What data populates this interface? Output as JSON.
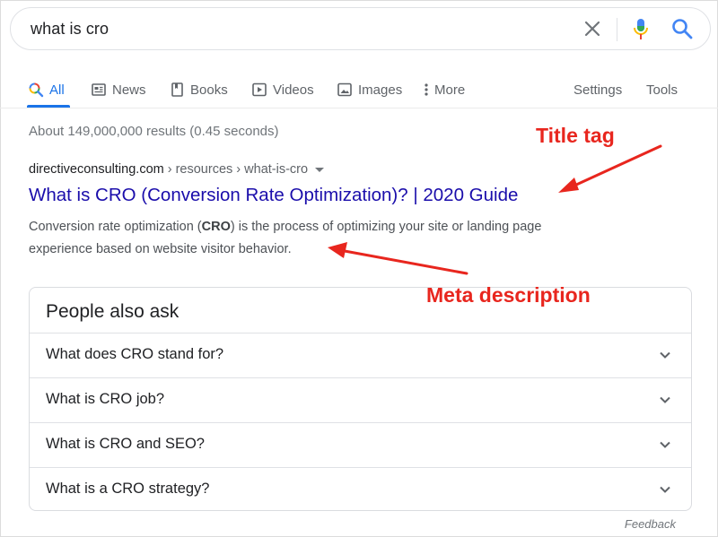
{
  "search": {
    "query": "what is cro",
    "icons": [
      "close-icon",
      "microphone-icon",
      "search-icon"
    ]
  },
  "tabs": [
    {
      "label": "All",
      "icon": "search-colorful-icon",
      "active": true
    },
    {
      "label": "News",
      "icon": "news-icon"
    },
    {
      "label": "Books",
      "icon": "book-icon"
    },
    {
      "label": "Videos",
      "icon": "video-icon"
    },
    {
      "label": "Images",
      "icon": "image-icon"
    },
    {
      "label": "More",
      "icon": "more-vert-icon"
    }
  ],
  "tools": {
    "settings": "Settings",
    "tools": "Tools"
  },
  "result_stats": "About 149,000,000 results (0.45 seconds)",
  "result": {
    "domain": "directiveconsulting.com",
    "breadcrumb": " › resources › what-is-cro",
    "title": "What is CRO (Conversion Rate Optimization)? | 2020 Guide",
    "snippet_before": "Conversion rate optimization (",
    "snippet_bold": "CRO",
    "snippet_after": ") is the process of optimizing your site or landing page experience based on website visitor behavior."
  },
  "annotations": {
    "title_tag": "Title tag",
    "meta_description": "Meta description",
    "color": "#e8261e"
  },
  "people_also_ask": {
    "heading": "People also ask",
    "questions": [
      "What does CRO stand for?",
      "What is CRO job?",
      "What is CRO and SEO?",
      "What is a CRO strategy?"
    ]
  },
  "feedback": "Feedback",
  "colors": {
    "link": "#1a0dab",
    "accent": "#1a73e8",
    "muted": "#70757a"
  }
}
